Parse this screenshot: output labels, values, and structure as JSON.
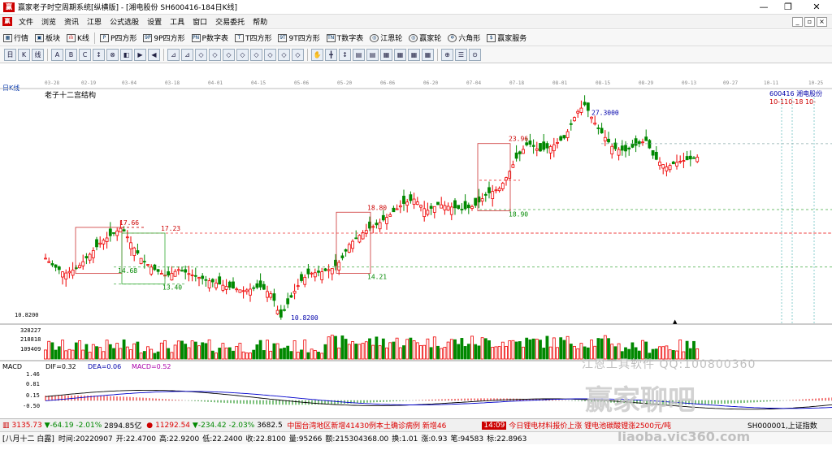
{
  "window": {
    "title": "赢家老子时空周期系统[纵横版] - [湘电股份  SH600416-184日K线]",
    "min": "—",
    "max": "❐",
    "close": "✕"
  },
  "menu": {
    "items": [
      "文件",
      "浏览",
      "资讯",
      "江恩",
      "公式选股",
      "设置",
      "工具",
      "窗口",
      "交易委托",
      "帮助"
    ]
  },
  "toolbar1": {
    "items": [
      "行情",
      "板块",
      "K线",
      "P四方形",
      "9P四方形",
      "P数字表",
      "T四方形",
      "9T四方形",
      "T数字表",
      "江恩轮",
      "赢家轮",
      "六角形",
      "赢家服务"
    ]
  },
  "toolbar2": {
    "icons": [
      "日",
      "K",
      "线",
      "A",
      "B",
      "C",
      "↕",
      "⊗",
      "◧",
      "▶",
      "◀",
      "⊿",
      "⊿",
      "◇",
      "◇",
      "◇",
      "◇",
      "◇",
      "◇",
      "◇",
      "◇",
      "✋",
      "╋",
      "↕",
      "▤",
      "▤",
      "▦",
      "▦",
      "▦",
      "▦",
      "⊕",
      "☰",
      "⊙"
    ]
  },
  "chart": {
    "period_label": "日K线",
    "title": "老子十二宫结构",
    "stock_code": "600416",
    "stock_name": "湘电股份",
    "date_ticks": [
      "03-28",
      "02-19",
      "03-04",
      "03-18",
      "04-01",
      "04-15",
      "05-06",
      "05-20",
      "06-06",
      "06-20",
      "07-04",
      "07-18",
      "08-01",
      "08-15",
      "08-29",
      "09-13",
      "09-27",
      "10-11",
      "10-25"
    ],
    "right_dates": "10-110-18",
    "right_date2": "10-",
    "low_label": "10.8200",
    "high_label": "27.3000",
    "levels": {
      "a": "17.66",
      "b": "17.23",
      "c": "14.68",
      "d": "13.40",
      "e": "18.80",
      "f": "14.21",
      "g": "23.96",
      "h": "18.90",
      "low": "10.8200",
      "high": "27.3000"
    },
    "volume_axis": [
      "328227",
      "218818",
      "109409"
    ],
    "macd_axis": [
      "1.46",
      "0.81",
      "0.15",
      "-0.50"
    ]
  },
  "chart_data": {
    "type": "candlestick",
    "title": "老子十二宫结构",
    "low": 10.82,
    "high": 27.3,
    "annotations": [
      "17.66",
      "17.23",
      "14.68",
      "13.40",
      "18.80",
      "14.21",
      "23.96",
      "18.90",
      "10.8200",
      "27.3000"
    ]
  },
  "macd": {
    "label": "MACD",
    "dif": "DIF=0.32",
    "dea": "DEA=0.06",
    "macd": "MACD=0.52"
  },
  "watermark": {
    "line1": "江恩工具软件  QQ:100800360",
    "line2": "赢家聊吧",
    "line3": "liaoba.vic360.com"
  },
  "status": {
    "idx1": "3135.73",
    "idx1chg": "▼-64.19",
    "idx1pct": "-2.01%",
    "idx1vol": "2894.85亿",
    "idx2": "11292.54",
    "idx2chg": "▼-234.42",
    "idx2pct": "-2.03%",
    "idx2vol": "3682.5",
    "news1": "中国台湾地区新增41430例本土确诊病例 新增46",
    "time": "14:09",
    "news2": "今日锂电材料报价上涨 锂电池碳酸锂涨2500元/吨",
    "idx_right": "SH000001,上证指数"
  },
  "status2": {
    "lunar": "[八月十二 白露]",
    "date": "时间:20220907",
    "open": "开:22.4700",
    "high": "高:22.9200",
    "low": "低:22.2400",
    "close": "收:22.8100",
    "vol": "量:95266",
    "amt": "额:215304368.00",
    "turn": "换:1.01",
    "chg": "涨:0.93",
    "cnt": "笔:94583",
    "ma": "标:22.8963"
  }
}
